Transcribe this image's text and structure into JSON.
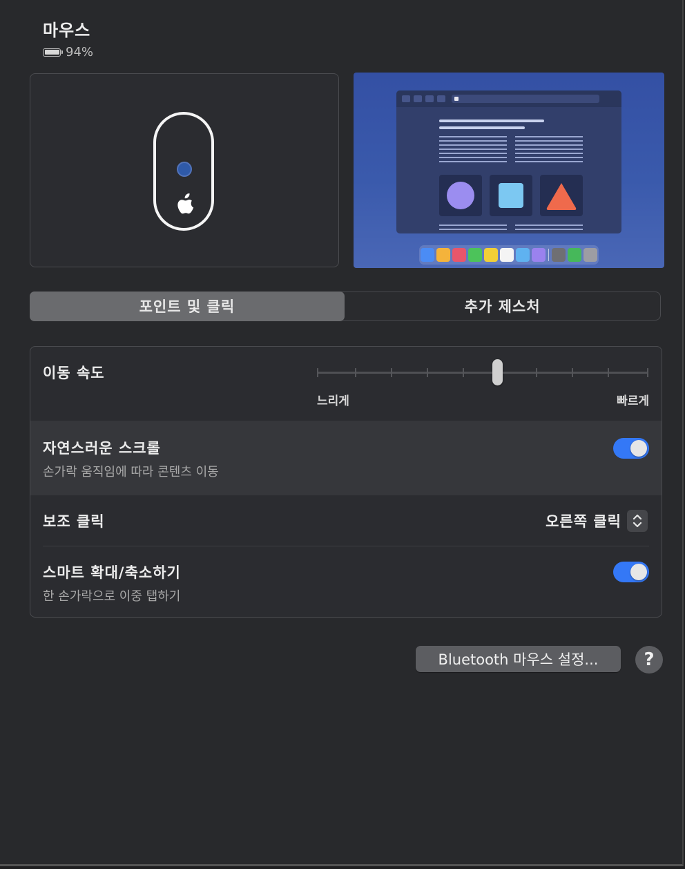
{
  "header": {
    "title": "마우스",
    "battery_level": "94%"
  },
  "tabs": [
    {
      "label": "포인트 및 클릭",
      "active": true
    },
    {
      "label": "추가 제스처",
      "active": false
    }
  ],
  "settings": {
    "tracking_speed": {
      "label": "이동 속도",
      "min_label": "느리게",
      "max_label": "빠르게",
      "value_fraction": 0.545
    },
    "natural_scroll": {
      "label": "자연스러운 스크롤",
      "description": "손가락 움직임에 따라 콘텐츠 이동",
      "enabled": true
    },
    "secondary_click": {
      "label": "보조 클릭",
      "value": "오른쪽 클릭"
    },
    "smart_zoom": {
      "label": "스마트 확대/축소하기",
      "description": "한 손가락으로 이중 탭하기",
      "enabled": true
    }
  },
  "footer": {
    "bluetooth_button": "Bluetooth 마우스 설정...",
    "help_button": "?"
  },
  "colors": {
    "accent": "#3478f6",
    "window_bg": "#28292c",
    "highlight_row": "#37383c",
    "desktop_preview": "#3450a4"
  },
  "icons": {
    "battery": "battery-icon",
    "mouse": "magic-mouse-icon",
    "apple": "apple-logo-icon",
    "popup": "chevron-up-down-icon"
  }
}
